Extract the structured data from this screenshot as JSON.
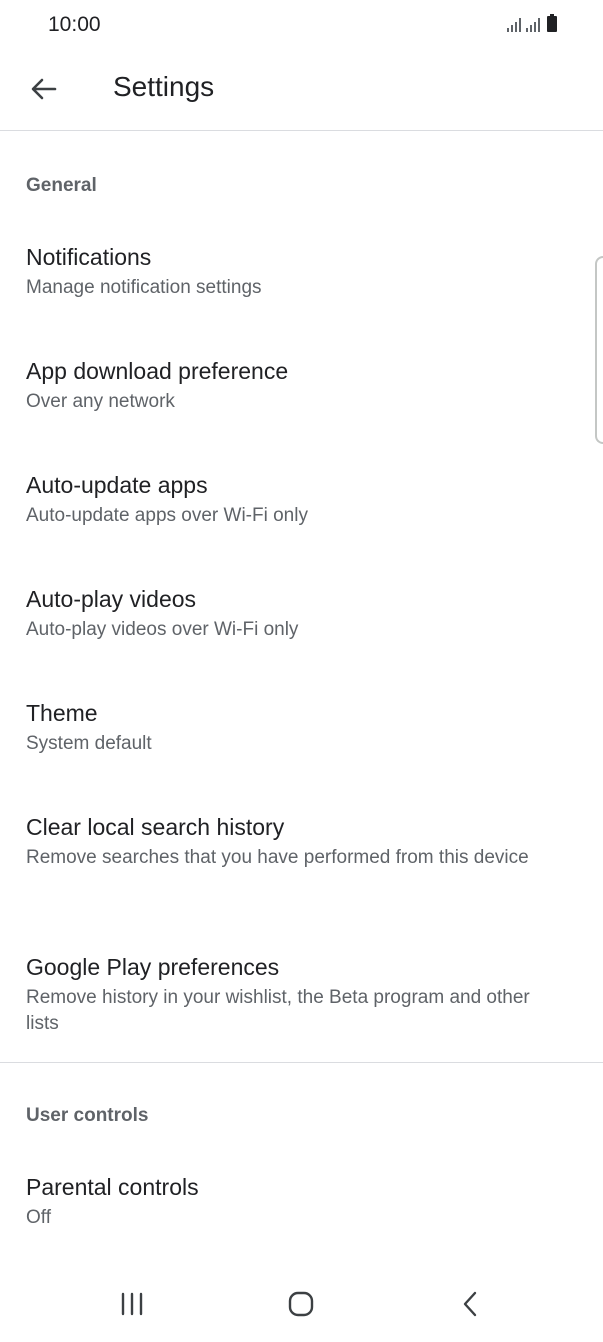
{
  "status_bar": {
    "time": "10:00",
    "icons": [
      "signal-icon",
      "signal-icon",
      "battery-icon"
    ]
  },
  "app_bar": {
    "back_icon": "arrow-back-icon",
    "title": "Settings"
  },
  "sections": {
    "general": {
      "header": "General",
      "items": [
        {
          "title": "Notifications",
          "subtitle": "Manage notification settings"
        },
        {
          "title": "App download preference",
          "subtitle": "Over any network"
        },
        {
          "title": "Auto-update apps",
          "subtitle": "Auto-update apps over Wi-Fi only"
        },
        {
          "title": "Auto-play videos",
          "subtitle": "Auto-play videos over Wi-Fi only"
        },
        {
          "title": "Theme",
          "subtitle": "System default"
        },
        {
          "title": "Clear local search history",
          "subtitle": "Remove searches that you have performed from this device"
        },
        {
          "title": "Google Play preferences",
          "subtitle": "Remove history in your wishlist, the Beta program and other lists"
        }
      ]
    },
    "user_controls": {
      "header": "User controls",
      "items": [
        {
          "title": "Parental controls",
          "subtitle": "Off"
        }
      ]
    }
  },
  "nav_bar": {
    "buttons": [
      "recent-apps-icon",
      "home-icon",
      "back-icon"
    ]
  },
  "colors": {
    "primary_text": "#202124",
    "secondary_text": "#5f6368",
    "divider": "#dadce0",
    "background": "#ffffff"
  }
}
